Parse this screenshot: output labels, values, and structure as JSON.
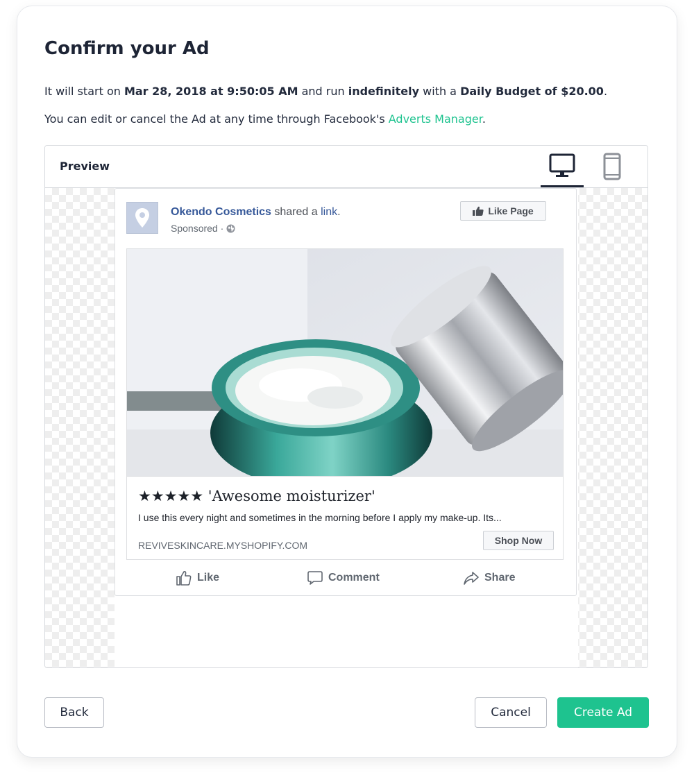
{
  "dialog": {
    "title": "Confirm your Ad",
    "line1": {
      "t1": "It will start on ",
      "date": "Mar 28, 2018 at 9:50:05 AM",
      "t2": " and run ",
      "duration": "indefinitely",
      "t3": " with a ",
      "budget": "Daily Budget of $20.00",
      "t4": "."
    },
    "line2": {
      "t1": "You can edit or cancel the Ad at any time through Facebook's ",
      "link": "Adverts Manager",
      "t2": "."
    }
  },
  "preview": {
    "label": "Preview",
    "devices": [
      {
        "name": "desktop",
        "icon": "desktop-icon",
        "selected": true
      },
      {
        "name": "mobile",
        "icon": "mobile-icon",
        "selected": false
      }
    ]
  },
  "post": {
    "page_name": "Okendo Cosmetics",
    "shared_text": " shared a ",
    "shared_link": "link",
    "shared_end": ".",
    "sponsored": "Sponsored ·",
    "like_page": "Like Page",
    "headline": "★★★★★ 'Awesome moisturizer'",
    "description": "I use this every night and sometimes in the morning before I apply my make-up. Its...",
    "domain": "REVIVESKINCARE.MYSHOPIFY.COM",
    "cta": "Shop Now",
    "actions": {
      "like": "Like",
      "comment": "Comment",
      "share": "Share"
    }
  },
  "footer": {
    "back": "Back",
    "cancel": "Cancel",
    "create": "Create Ad"
  },
  "colors": {
    "accent": "#1ec38f",
    "facebook_link": "#365899",
    "text_dark": "#1d2435"
  }
}
